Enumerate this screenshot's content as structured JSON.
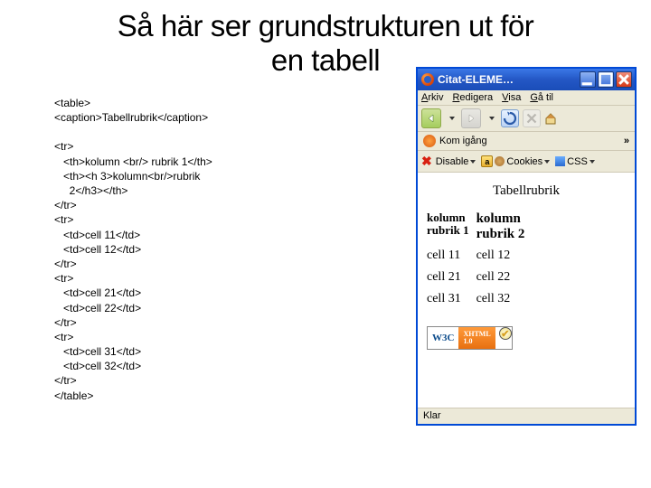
{
  "title_line1": "Så här ser grundstrukturen ut för",
  "title_line2": "en tabell",
  "code": "<table>\n<caption>Tabellrubrik</caption>\n\n<tr>\n   <th>kolumn <br/> rubrik 1</th>\n   <th><h 3>kolumn<br/>rubrik\n     2</h3></th>\n</tr>\n<tr>\n   <td>cell 11</td>\n   <td>cell 12</td>\n</tr>\n<tr>\n   <td>cell 21</td>\n   <td>cell 22</td>\n</tr>\n<tr>\n   <td>cell 31</td>\n   <td>cell 32</td>\n</tr>\n</table>",
  "browser": {
    "title": "Citat-ELEME…",
    "menu": {
      "arkiv": "Arkiv",
      "redigera": "Redigera",
      "visa": "Visa",
      "ga_til": "Gå til"
    },
    "bookmark_label": "Kom igång",
    "toolbar": {
      "disable": "Disable",
      "cookies": "Cookies",
      "css": "CSS"
    },
    "page": {
      "caption": "Tabellrubrik",
      "head": {
        "c1a": "kolumn",
        "c1b": "rubrik 1",
        "c2a": "kolumn",
        "c2b": "rubrik 2"
      },
      "rows": [
        {
          "c1": "cell 11",
          "c2": "cell 12"
        },
        {
          "c1": "cell 21",
          "c2": "cell 22"
        },
        {
          "c1": "cell 31",
          "c2": "cell 32"
        }
      ],
      "w3c_left": "W3C",
      "w3c_r1": "XHTML",
      "w3c_r2": "1.0"
    },
    "status": "Klar",
    "chevrons": "»"
  }
}
